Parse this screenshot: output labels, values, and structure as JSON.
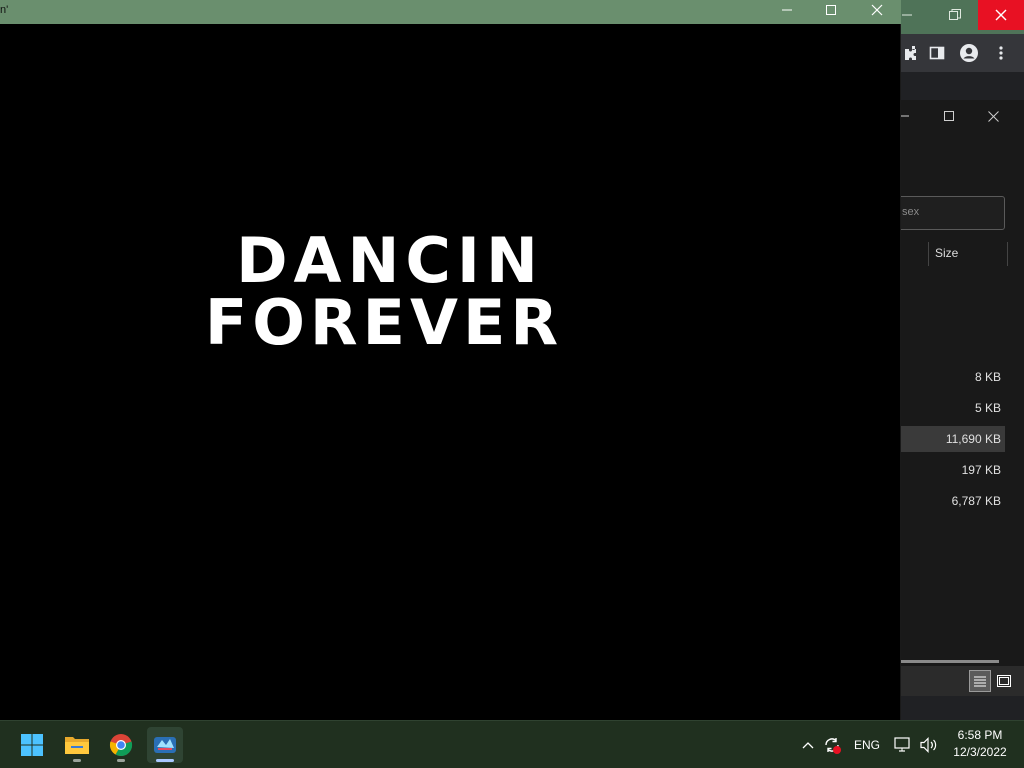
{
  "video_window": {
    "title": "n'",
    "art_line1": "DANCIN",
    "art_line2": "FOREVER"
  },
  "browser": {
    "close_color": "#e81123"
  },
  "explorer": {
    "search_placeholder": "sex",
    "size_header": "Size",
    "sizes": [
      "8 KB",
      "5 KB",
      "11,690 KB",
      "197 KB",
      "6,787 KB"
    ],
    "selected_index": 2
  },
  "taskbar": {
    "apps": [
      "start-icon",
      "file-explorer-icon",
      "chrome-icon",
      "game-app-icon"
    ],
    "language": "ENG",
    "time": "6:58 PM",
    "date": "12/3/2022"
  }
}
